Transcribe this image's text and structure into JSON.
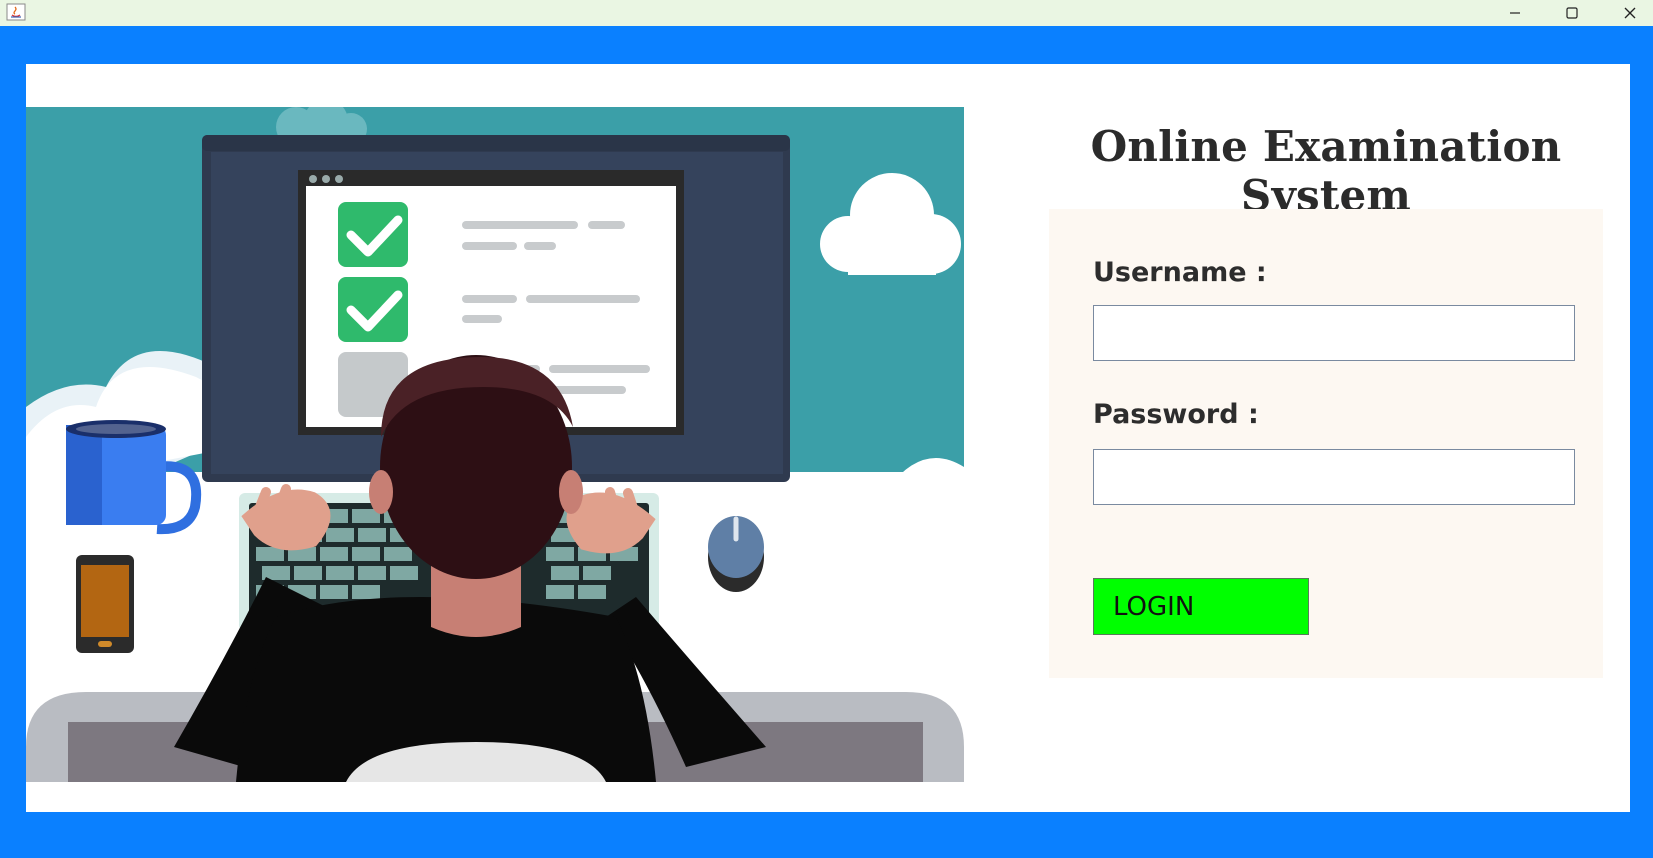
{
  "window": {
    "controls": {
      "minimize_icon": "minimize-icon",
      "maximize_icon": "maximize-icon",
      "close_icon": "close-icon"
    }
  },
  "header": {
    "title": "Online Examination System"
  },
  "form": {
    "username_label": "Username :",
    "username_value": "",
    "password_label": "Password :",
    "password_value": "",
    "login_label": "LOGIN"
  },
  "colors": {
    "frame_blue": "#0a80ff",
    "login_green": "#00ff00",
    "card_bg": "#fdf8f2",
    "illustration_sky": "#3b9fa8"
  }
}
